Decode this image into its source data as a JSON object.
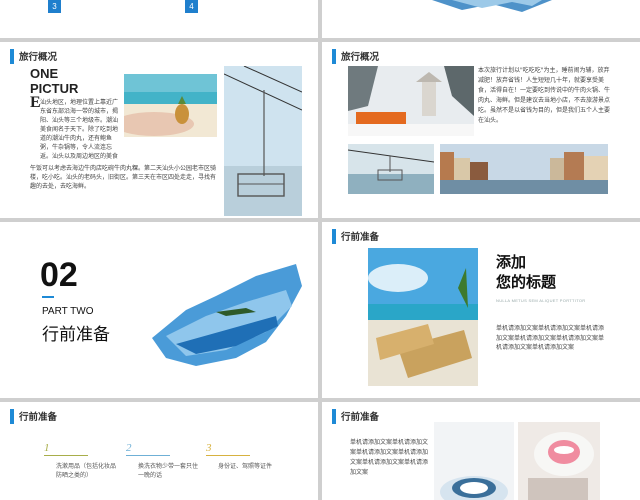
{
  "colors": {
    "accent": "#1e8ad6",
    "slide_bg": "#ffffff",
    "gutter": "#cfcfcf"
  },
  "slide1": {
    "badge_a": "3",
    "badge_b": "4"
  },
  "slide3": {
    "header": "旅行概况",
    "big_title_line1": "ONE",
    "big_title_line2": "PICTUR",
    "drop_cap": "E",
    "para1": "汕头地区，地理位置上靠近广东省东部沿海一带的城市，揭阳、汕头等三个地级市。潮汕美食闻名于天下。除了吃到地道的潮汕牛肉丸，还有鲍鱼粥，牛杂锅等，令人流连忘返。汕头以及周边地区的美食让人不禁一吃再吃，广济桥，牌坊街，开元寺。",
    "para2": "午饭可以考虑去海边牛肉店吃碗牛肉丸粿。第二天汕头小公园老市区骑楼，吃小吃。汕头的老码头，旧街区。第三天在市区四处走走，寻找有趣的去处，去吃海鲜。"
  },
  "slide4": {
    "header": "旅行概况",
    "body": "本次旅行计划以\"吃吃吃\"为主，睡前闹为辅，放弃减肥！放弃省钱！人生短短几十年，就要享受美食，活得自在！一定要吃到传说中的牛肉火锅、牛肉丸、海鲜。但是建议去当地小店，不去旅游景点吃。虽然不是以省钱为目的，但是我们五个人主要在汕头。"
  },
  "slide5": {
    "number": "02",
    "part": "PART  TWO",
    "title": "行前准备"
  },
  "slide6": {
    "header": "行前准备",
    "title_line1": "添加",
    "title_line2": "您的标题",
    "subtitle": "NULLA METUS SEM ALIQUET PORTTITOR",
    "body": "单机请添加文案单机请添加文案单机请添加文案单机请添加文案单机请添加文案单机请添加文案单机请添加文案"
  },
  "slide7": {
    "header": "行前准备",
    "items": [
      {
        "num": "1",
        "text": "洗漱用品（包括化妆品防晒之类的）",
        "color": "#a8ae4a"
      },
      {
        "num": "2",
        "text": "换洗衣物少带一套只住一晚的话",
        "color": "#6fb0d6"
      },
      {
        "num": "3",
        "text": "身份证、驾照等证件",
        "color": "#d7b240"
      }
    ]
  },
  "slide8": {
    "header": "行前准备",
    "body": "单机请添加文案单机请添加文案单机请添加文案单机请添加文案单机请添加文案单机请添加文案"
  }
}
